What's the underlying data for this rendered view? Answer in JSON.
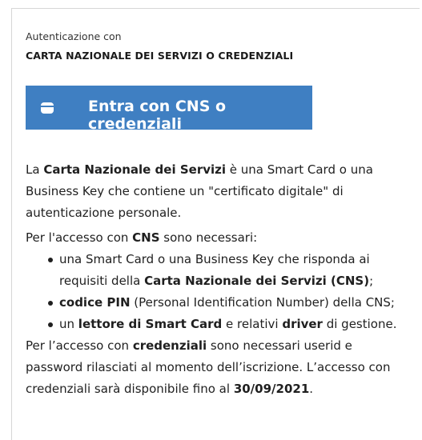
{
  "auth": {
    "pretitle": "Autenticazione con",
    "title": "CARTA NAZIONALE DEI SERVIZI O CREDENZIALI",
    "button_label": "Entra con CNS o credenziali",
    "button_icon": "card-icon",
    "accent_color": "#3f7fc2"
  },
  "desc": {
    "p1": {
      "a": "La ",
      "b": "Carta Nazionale dei Servizi",
      "c": " è una Smart Card o una Business Key che contiene un \"certificato digitale\" di autenticazione personale."
    },
    "p2": {
      "a": "Per l'accesso con ",
      "b": "CNS",
      "c": " sono necessari:"
    },
    "li1": {
      "a": "una Smart Card o una Business Key che risponda ai requisiti della ",
      "b": "Carta Nazionale dei Servizi (CNS)",
      "c": ";"
    },
    "li2": {
      "a": "codice PIN",
      "b": " (Personal Identification Number) della CNS;"
    },
    "li3": {
      "a": "un ",
      "b": "lettore di Smart Card",
      "c": " e relativi ",
      "d": "driver",
      "e": " di gestione."
    },
    "p3": {
      "a": "Per l’accesso con ",
      "b": "credenziali",
      "c": " sono necessari userid e password rilasciati al momento dell’iscrizione. L’accesso con credenziali sarà disponibile fino al ",
      "d": "30/09/2021",
      "e": "."
    }
  }
}
